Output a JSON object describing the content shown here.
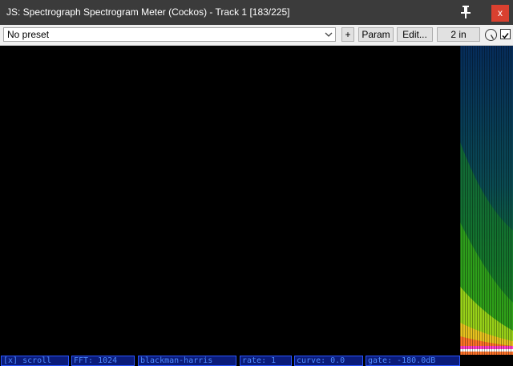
{
  "window": {
    "title": "JS: Spectrograph Spectrogram Meter (Cockos) - Track 1 [183/225]",
    "close_label": "x",
    "pin_icon": "pin-icon",
    "titlebar_color": "#3b3b3b",
    "close_color": "#d9402f"
  },
  "toolbar": {
    "preset_value": "No preset",
    "add_label": "+",
    "param_label": "Param",
    "edit_label": "Edit...",
    "io_label": "2 in",
    "wet_knob_icon": "knob-icon",
    "bypass_checked": true
  },
  "statusbar": {
    "items": [
      "[x] scroll",
      "FFT: 1024",
      "blackman-harris",
      "rate: 1",
      "curve: 0.0",
      "gate: -180.0dB"
    ],
    "text_color": "#4f8cff",
    "box_color": "#0a1b7a"
  }
}
